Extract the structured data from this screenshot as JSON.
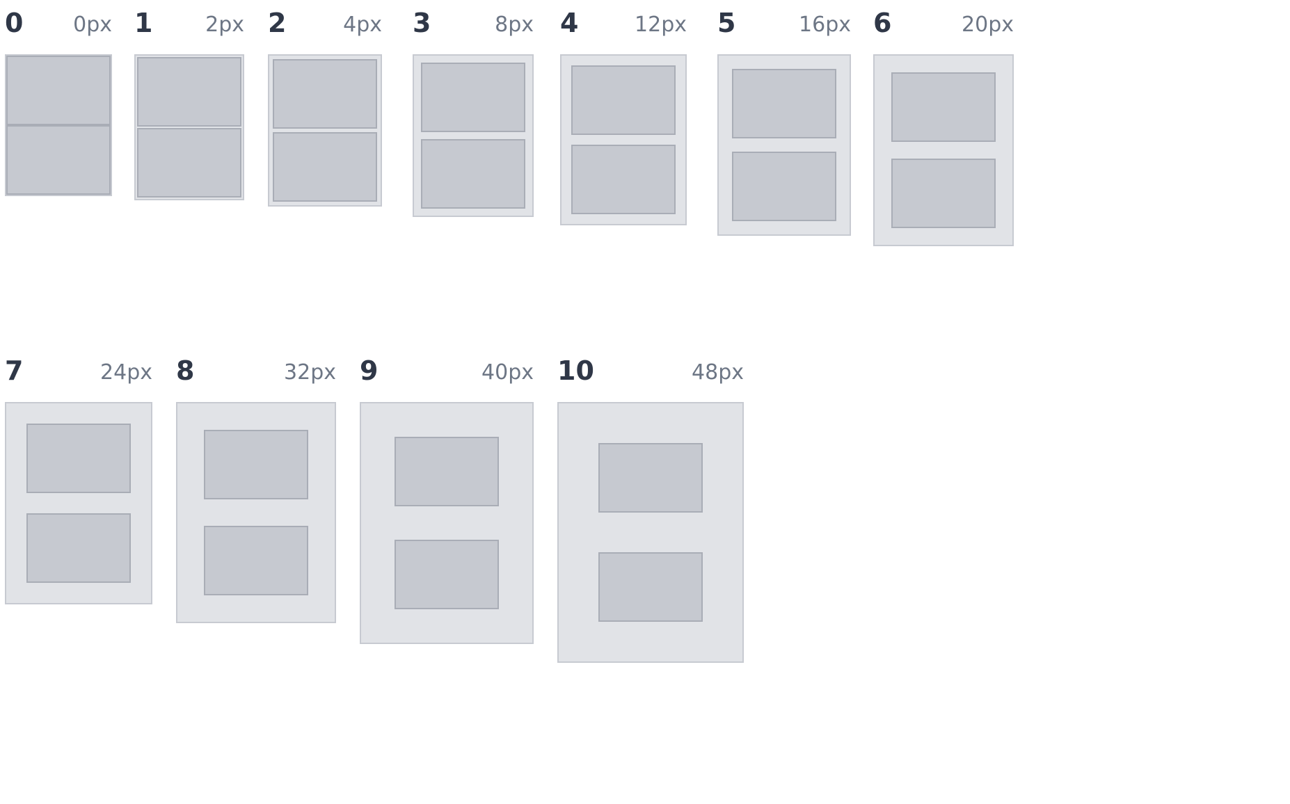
{
  "spacing_scale": [
    {
      "step": "0",
      "value_label": "0px",
      "value": 0
    },
    {
      "step": "1",
      "value_label": "2px",
      "value": 2
    },
    {
      "step": "2",
      "value_label": "4px",
      "value": 4
    },
    {
      "step": "3",
      "value_label": "8px",
      "value": 8
    },
    {
      "step": "4",
      "value_label": "12px",
      "value": 12
    },
    {
      "step": "5",
      "value_label": "16px",
      "value": 16
    },
    {
      "step": "6",
      "value_label": "20px",
      "value": 20
    },
    {
      "step": "7",
      "value_label": "24px",
      "value": 24
    },
    {
      "step": "8",
      "value_label": "32px",
      "value": 32
    },
    {
      "step": "9",
      "value_label": "40px",
      "value": 40
    },
    {
      "step": "10",
      "value_label": "48px",
      "value": 48
    }
  ]
}
